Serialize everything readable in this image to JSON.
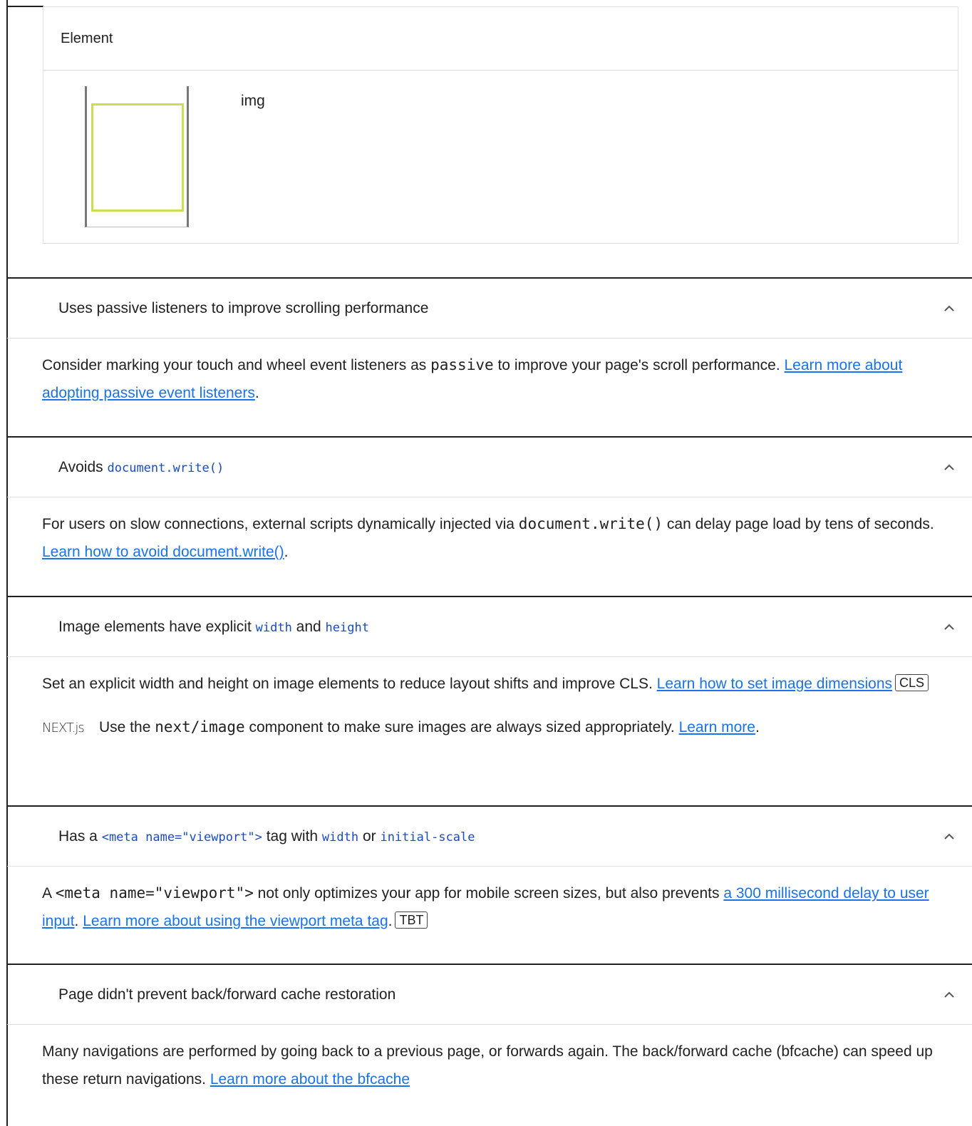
{
  "element_table": {
    "header": "Element",
    "rows": [
      {
        "node": "img"
      }
    ]
  },
  "audits": [
    {
      "title_parts": [
        {
          "text": "Uses passive listeners to improve scrolling performance"
        }
      ],
      "desc_before": "Consider marking your touch and wheel event listeners as ",
      "desc_code": "passive",
      "desc_after": " to improve your page's scroll performance. ",
      "link": "Learn more about adopting passive event listeners",
      "tail": "."
    },
    {
      "title_text": "Avoids ",
      "title_code": "document.write()",
      "desc_before": "For users on slow connections, external scripts dynamically injected via ",
      "desc_code": "document.write()",
      "desc_after": " can delay page load by tens of seconds. ",
      "link": "Learn how to avoid document.write()",
      "tail": "."
    },
    {
      "title_text": "Image elements have explicit ",
      "title_code1": "width",
      "title_mid": " and ",
      "title_code2": "height",
      "desc": "Set an explicit width and height on image elements to reduce layout shifts and improve CLS. ",
      "link": "Learn how to set image dimensions",
      "badge": "CLS",
      "stack_logo": "NEXT.js",
      "stack_before": "Use the ",
      "stack_code": "next/image",
      "stack_after": " component to make sure images are always sized appropriately. ",
      "stack_link": "Learn more",
      "stack_tail": "."
    },
    {
      "title_text": "Has a ",
      "title_code1": "<meta name=\"viewport\">",
      "title_mid": " tag with ",
      "title_code2": "width",
      "title_mid2": " or ",
      "title_code3": "initial-scale",
      "desc_prefix": "A ",
      "desc_code": "<meta name=\"viewport\">",
      "desc_after": " not only optimizes your app for mobile screen sizes, but also prevents ",
      "link1": "a 300 millisecond delay to user input",
      "mid": ". ",
      "link2": "Learn more about using the viewport meta tag",
      "tail": ".",
      "badge": "TBT"
    },
    {
      "title": "Page didn't prevent back/forward cache restoration",
      "desc": "Many navigations are performed by going back to a previous page, or forwards again. The back/forward cache (bfcache) can speed up these return navigations. ",
      "link": "Learn more about the bfcache"
    }
  ]
}
